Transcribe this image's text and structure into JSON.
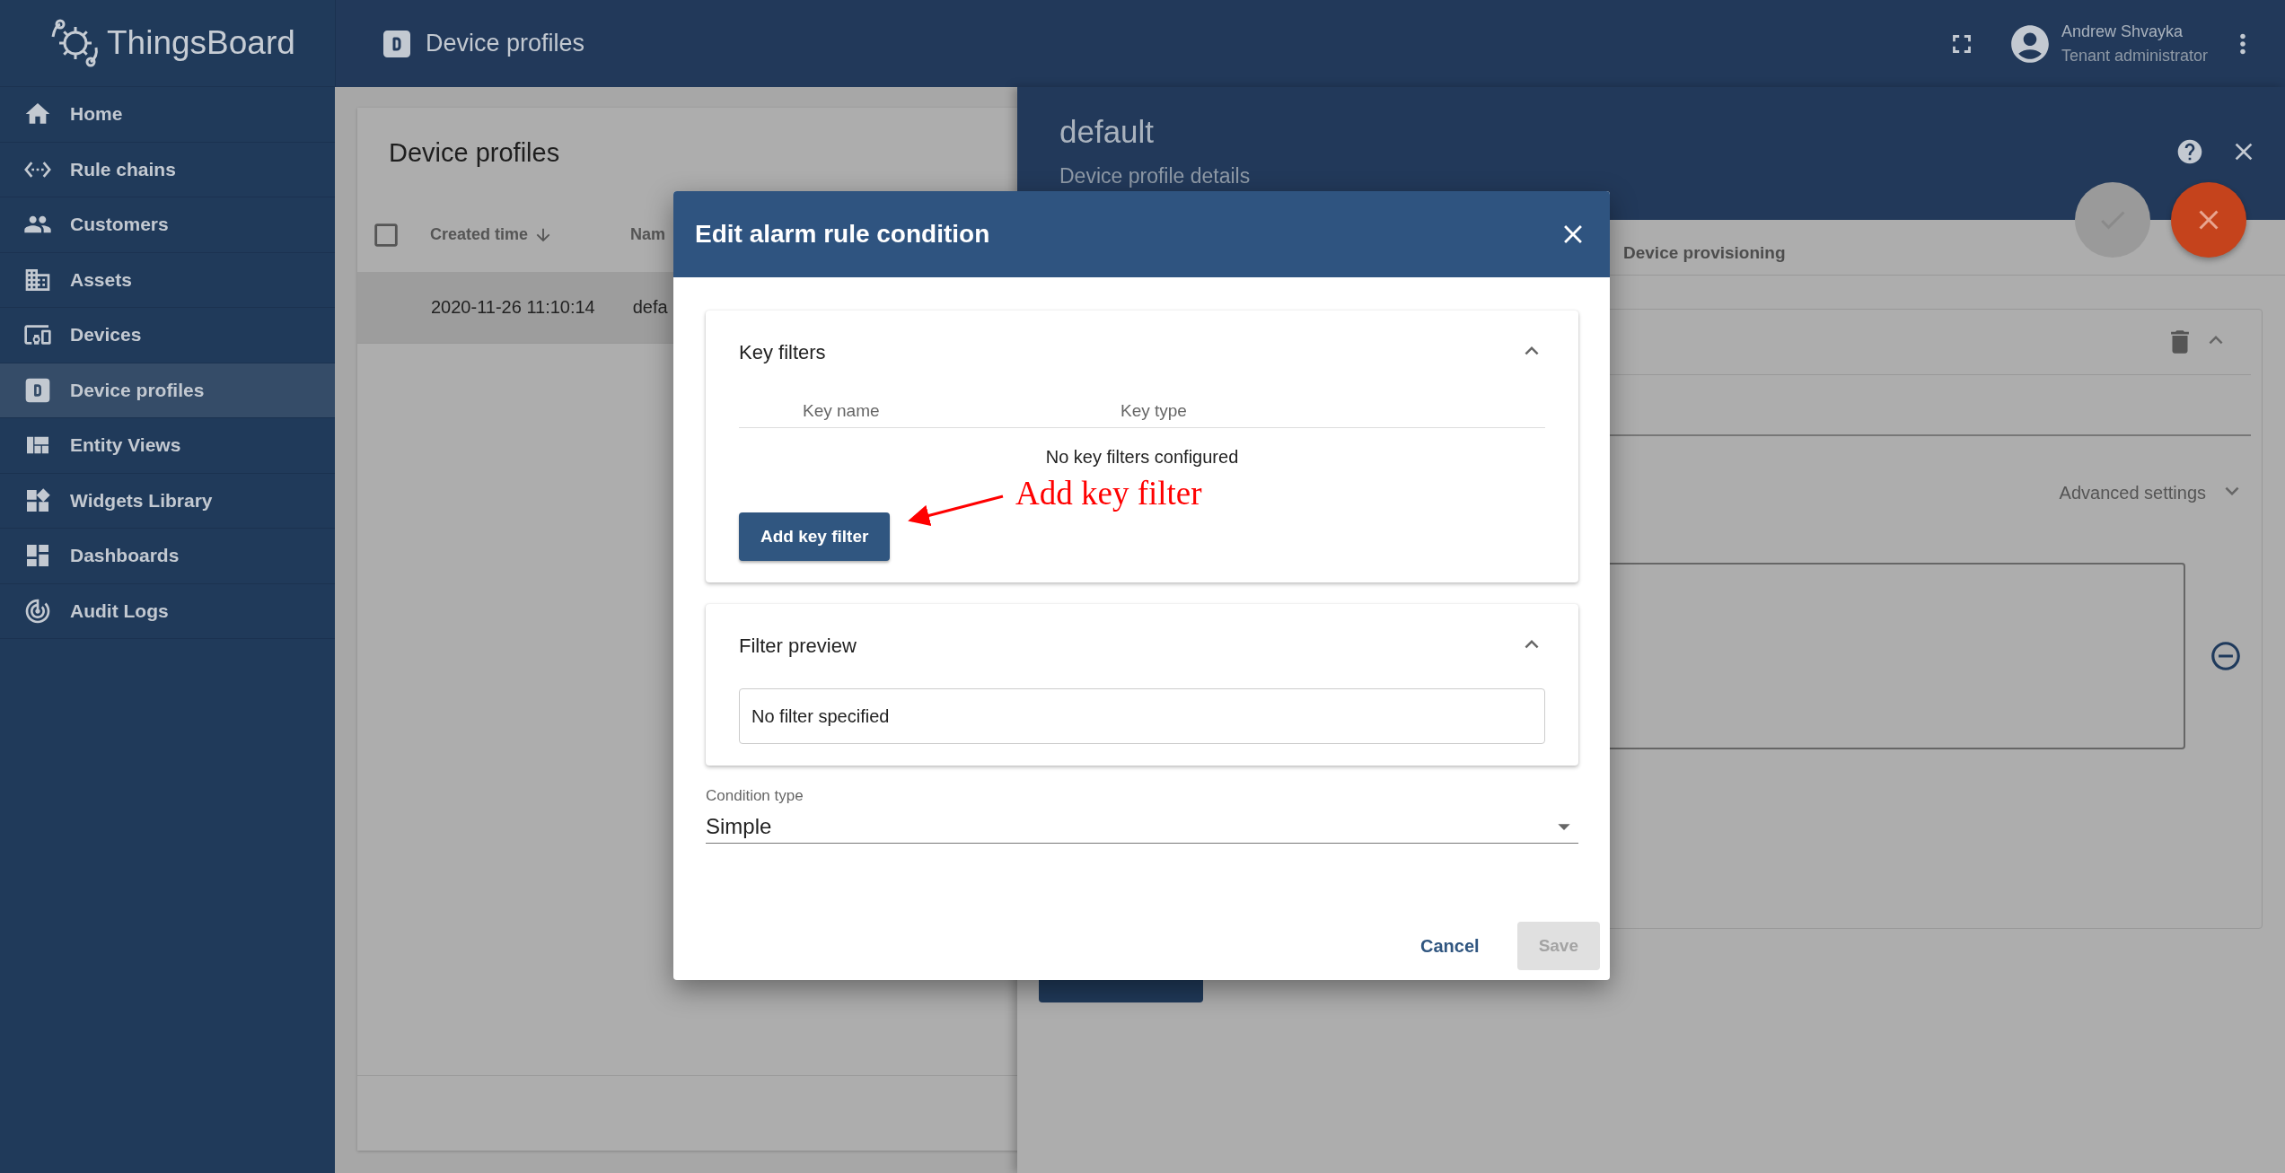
{
  "app": {
    "logo": "ThingsBoard"
  },
  "top_bar": {
    "title": "Device profiles",
    "user": {
      "name": "Andrew Shvayka",
      "role": "Tenant administrator"
    }
  },
  "sidebar": {
    "items": [
      {
        "label": "Home",
        "selected": false
      },
      {
        "label": "Rule chains",
        "selected": false
      },
      {
        "label": "Customers",
        "selected": false
      },
      {
        "label": "Assets",
        "selected": false
      },
      {
        "label": "Devices",
        "selected": false
      },
      {
        "label": "Device profiles",
        "selected": true
      },
      {
        "label": "Entity Views",
        "selected": false
      },
      {
        "label": "Widgets Library",
        "selected": false
      },
      {
        "label": "Dashboards",
        "selected": false
      },
      {
        "label": "Audit Logs",
        "selected": false
      }
    ]
  },
  "list_panel": {
    "title": "Device profiles",
    "select_all": {
      "checked": false
    },
    "columns": [
      {
        "label": "Created time",
        "sorted": true
      },
      {
        "label": "Nam",
        "sorted": false
      }
    ],
    "rows": [
      {
        "created_time": "2020-11-26 11:10:14",
        "name": "defa",
        "selected": true
      }
    ]
  },
  "details": {
    "title": "default",
    "subtitle": "Device profile details",
    "tabs": [
      {
        "label": "Device provisioning",
        "selected": false
      }
    ],
    "rule_expanded": true,
    "advanced_settings": {
      "label": "Advanced settings",
      "expanded": false
    }
  },
  "dialog": {
    "title": "Edit alarm rule condition",
    "key_filters": {
      "title": "Key filters",
      "expanded": true,
      "columns": [
        "Key name",
        "Key type"
      ],
      "empty_text": "No key filters configured",
      "add_button": "Add key filter"
    },
    "filter_preview": {
      "title": "Filter preview",
      "expanded": true,
      "value": "No filter specified"
    },
    "condition_type": {
      "label": "Condition type",
      "value": "Simple"
    },
    "buttons": [
      {
        "label": "Cancel",
        "kind": "text",
        "disabled": false
      },
      {
        "label": "Save",
        "kind": "raised",
        "disabled": true
      }
    ]
  },
  "annotation": {
    "text": "Add key filter"
  }
}
